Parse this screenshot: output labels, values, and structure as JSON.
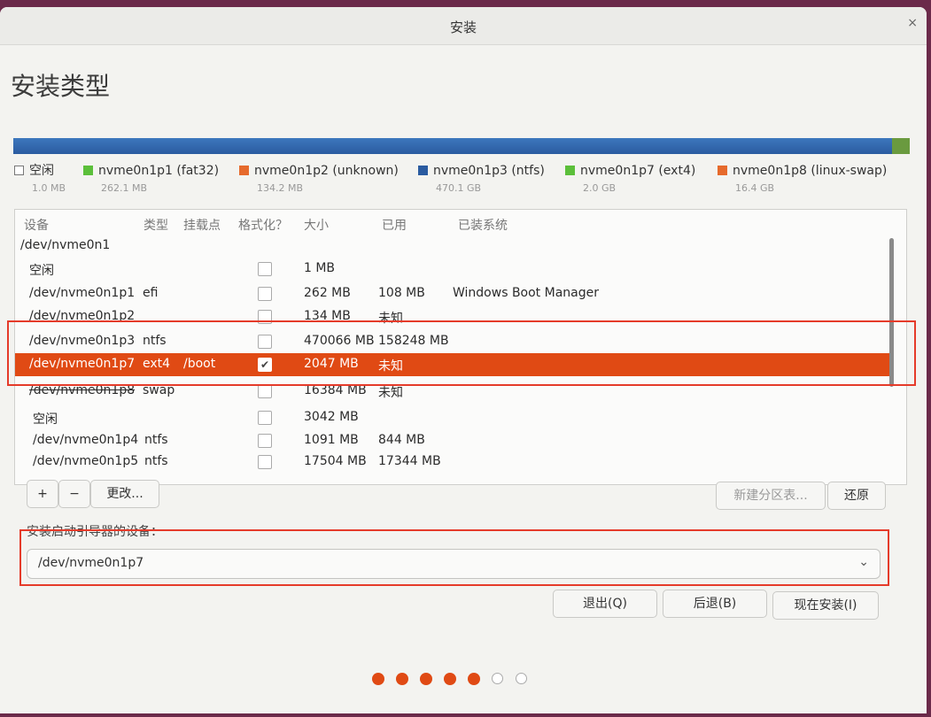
{
  "window": {
    "title": "安装",
    "close": "×"
  },
  "page_title": "安装类型",
  "legend": [
    {
      "label": "空闲",
      "size": "1.0 MB",
      "color": ""
    },
    {
      "label": "nvme0n1p1 (fat32)",
      "size": "262.1 MB",
      "color": "#5bbf3a"
    },
    {
      "label": "nvme0n1p2 (unknown)",
      "size": "134.2 MB",
      "color": "#e66a2c"
    },
    {
      "label": "nvme0n1p3 (ntfs)",
      "size": "470.1 GB",
      "color": "#2a5ba0"
    },
    {
      "label": "nvme0n1p7 (ext4)",
      "size": "2.0 GB",
      "color": "#5bbf3a"
    },
    {
      "label": "nvme0n1p8 (linux-swap)",
      "size": "16.4 GB",
      "color": "#e66a2c"
    }
  ],
  "table": {
    "headers": {
      "device": "设备",
      "type": "类型",
      "mount": "挂载点",
      "format": "格式化？",
      "size": "大小",
      "used": "已用",
      "system": "已装系统"
    },
    "disk": "/dev/nvme0n1",
    "rows": [
      {
        "device": "空闲",
        "type": "",
        "mount": "",
        "checked": false,
        "size": "1 MB",
        "used": "",
        "system": ""
      },
      {
        "device": "/dev/nvme0n1p1",
        "type": "efi",
        "mount": "",
        "checked": false,
        "size": "262 MB",
        "used": "108 MB",
        "system": "Windows Boot Manager"
      },
      {
        "device": "/dev/nvme0n1p2",
        "type": "",
        "mount": "",
        "checked": false,
        "size": "134 MB",
        "used": "未知",
        "system": ""
      },
      {
        "device": "/dev/nvme0n1p3",
        "type": "ntfs",
        "mount": "",
        "checked": false,
        "size": "470066 MB",
        "used": "158248 MB",
        "system": ""
      },
      {
        "device": "/dev/nvme0n1p7",
        "type": "ext4",
        "mount": "/boot",
        "checked": true,
        "check_mark": "✔",
        "size": "2047 MB",
        "used": "未知",
        "system": ""
      },
      {
        "device": "/dev/nvme0n1p8",
        "type": "swap",
        "mount": "",
        "checked": false,
        "size": "16384 MB",
        "used": "未知",
        "system": ""
      },
      {
        "device": "空闲",
        "type": "",
        "mount": "",
        "checked": false,
        "size": "3042 MB",
        "used": "",
        "system": ""
      },
      {
        "device": "/dev/nvme0n1p4",
        "type": "ntfs",
        "mount": "",
        "checked": false,
        "size": "1091 MB",
        "used": "844 MB",
        "system": ""
      },
      {
        "device": "/dev/nvme0n1p5",
        "type": "ntfs",
        "mount": "",
        "checked": false,
        "size": "17504 MB",
        "used": "17344 MB",
        "system": ""
      }
    ]
  },
  "toolbar": {
    "add": "+",
    "remove": "−",
    "change": "更改...",
    "new_table": "新建分区表...",
    "revert": "还原"
  },
  "bootloader": {
    "label": "安装启动引导器的设备：",
    "value": "/dev/nvme0n1p7",
    "chevron": "⌄"
  },
  "actions": {
    "quit": "退出(Q)",
    "back": "后退(B)",
    "install": "现在安装(I)"
  },
  "progress": {
    "total": 7,
    "completed": 5
  }
}
